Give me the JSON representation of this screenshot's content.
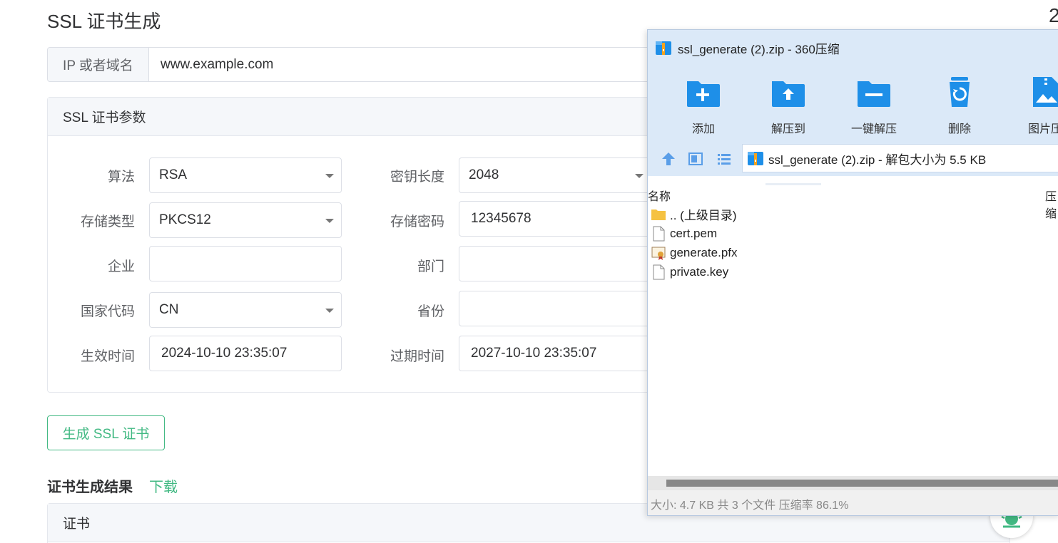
{
  "page": {
    "title": "SSL 证书生成",
    "corner_char": "2"
  },
  "domain": {
    "label": "IP 或者域名",
    "value": "www.example.com"
  },
  "params": {
    "header": "SSL 证书参数",
    "fields": {
      "algorithm": {
        "label": "算法",
        "value": "RSA"
      },
      "key_length": {
        "label": "密钥长度",
        "value": "2048"
      },
      "store_type": {
        "label": "存储类型",
        "value": "PKCS12"
      },
      "store_password": {
        "label": "存储密码",
        "value": "12345678"
      },
      "company": {
        "label": "企业",
        "value": ""
      },
      "department": {
        "label": "部门",
        "value": ""
      },
      "country_code": {
        "label": "国家代码",
        "value": "CN"
      },
      "province": {
        "label": "省份",
        "value": ""
      },
      "start_time": {
        "label": "生效时间",
        "value": "2024-10-10 23:35:07"
      },
      "expire_time": {
        "label": "过期时间",
        "value": "2027-10-10 23:35:07"
      }
    }
  },
  "actions": {
    "generate_label": "生成 SSL 证书"
  },
  "result": {
    "title": "证书生成结果",
    "download_label": "下载",
    "cert_header": "证书"
  },
  "zip_window": {
    "title": "ssl_generate (2).zip - 360压缩",
    "toolbar": [
      {
        "label": "添加",
        "icon": "add-folder-icon"
      },
      {
        "label": "解压到",
        "icon": "extract-to-icon"
      },
      {
        "label": "一键解压",
        "icon": "one-click-extract-icon"
      },
      {
        "label": "删除",
        "icon": "recycle-bin-icon"
      },
      {
        "label": "图片压",
        "icon": "image-compress-icon"
      }
    ],
    "path": "ssl_generate (2).zip - 解包大小为 5.5 KB",
    "columns": {
      "name": "名称",
      "size": "压缩"
    },
    "files": [
      {
        "name": ".. (上级目录)",
        "icon": "folder-icon"
      },
      {
        "name": "cert.pem",
        "icon": "file-icon"
      },
      {
        "name": "generate.pfx",
        "icon": "certificate-file-icon"
      },
      {
        "name": "private.key",
        "icon": "file-icon"
      }
    ],
    "status": "大小: 4.7 KB 共 3 个文件 压缩率 86.1%"
  },
  "colors": {
    "accent_green": "#42b983",
    "zip_toolbar_bg": "#dbe9f8",
    "zip_icon_blue": "#1e8fe8"
  }
}
